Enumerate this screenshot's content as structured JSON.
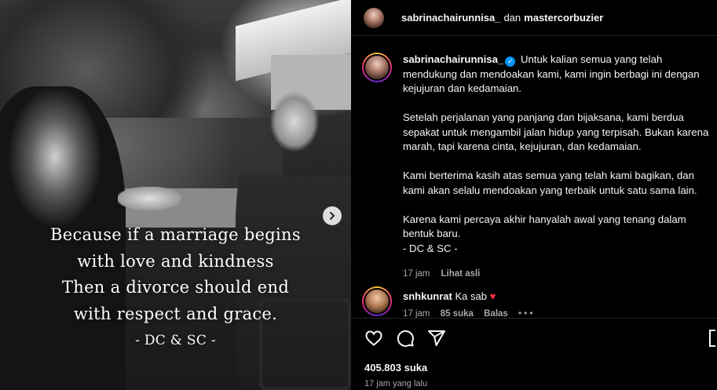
{
  "media": {
    "quote_lines": [
      "Because if a marriage begins",
      "with love and kindness",
      "Then a divorce should end",
      "with respect and grace."
    ],
    "quote_signature": "- DC & SC -",
    "next_icon": "chevron-right-icon"
  },
  "header": {
    "user1": "sabrinachairunnisa_",
    "conjunction": "dan",
    "user2": "mastercorbuzier"
  },
  "caption": {
    "username": "sabrinachairunnisa_",
    "verified_icon": "verified-badge-icon",
    "paragraph1": "Untuk kalian semua yang telah mendukung dan mendoakan kami, kami ingin berbagi ini dengan kejujuran dan kedamaian.",
    "paragraph2": "Setelah perjalanan yang panjang dan bijaksana, kami berdua sepakat untuk mengambil jalan hidup yang terpisah. Bukan karena marah, tapi karena cinta, kejujuran, dan kedamaian.",
    "paragraph3": "Kami berterima kasih atas semua yang telah kami bagikan, dan kami akan selalu mendoakan yang terbaik untuk satu sama lain.",
    "paragraph4_line1": "Karena kami percaya akhir hanyalah awal yang tenang dalam bentuk baru.",
    "paragraph4_line2": "- DC & SC -",
    "time": "17 jam",
    "see_translation": "Lihat asli"
  },
  "comment": {
    "username": "snhkunrat",
    "text": "Ka sab",
    "emoji": "♥",
    "time": "17 jam",
    "likes": "85 suka",
    "reply": "Balas",
    "more": "• • •"
  },
  "footer": {
    "like_icon": "heart-icon",
    "comment_icon": "comment-icon",
    "share_icon": "send-icon",
    "save_icon": "bookmark-icon",
    "likes_count": "405.803 suka",
    "posted_time": "17 jam yang lalu"
  }
}
